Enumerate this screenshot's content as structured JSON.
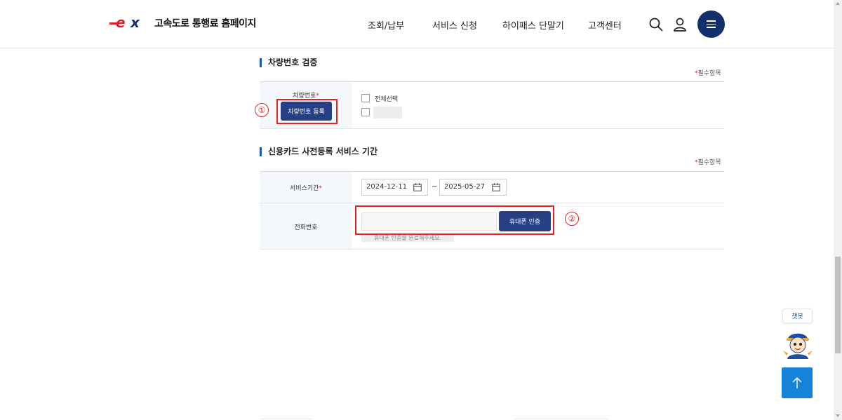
{
  "header": {
    "logo_mark": "ex",
    "site_title": "고속도로 통행료 홈페이지",
    "nav": [
      "조회/납부",
      "서비스 신청",
      "하이패스 단말기",
      "고객센터"
    ]
  },
  "section_vehicle": {
    "title": "차량번호 검증",
    "required_note": "필수항목",
    "field_label": "차량번호",
    "register_button": "차량번호 등록",
    "select_all_label": "전체선택"
  },
  "section_service": {
    "title": "신용카드 사전등록 서비스 기간",
    "required_note": "필수항목",
    "period_label": "서비스기간",
    "start_date": "2024-12-11",
    "tilde": "~",
    "end_date": "2025-05-27",
    "phone_label": "전화번호",
    "phone_value": "",
    "verify_button": "휴대폰 인증",
    "phone_hint": "휴대폰 인증을 완료해주세요."
  },
  "annotations": [
    "①",
    "②"
  ],
  "floating": {
    "chatbot_label": "챗봇",
    "top_icon": "arrow-up-icon"
  },
  "colors": {
    "brand_navy": "#14306b",
    "button_navy": "#263f85",
    "accent_red": "#e52222",
    "top_button_blue": "#1583d8"
  }
}
